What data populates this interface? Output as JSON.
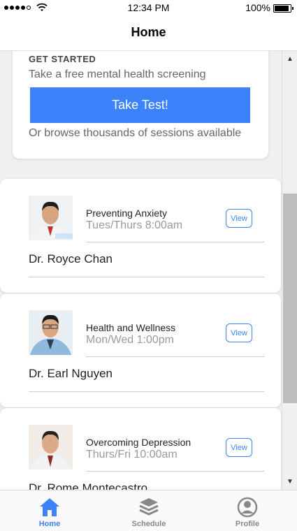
{
  "status_bar": {
    "time": "12:34 PM",
    "battery": "100%",
    "battery_level": 1.0
  },
  "header": {
    "title": "Home"
  },
  "get_started": {
    "heading": "GET STARTED",
    "subtitle": "Take a free mental health screening",
    "button": "Take Test!",
    "browse": "Or browse thousands of sessions available"
  },
  "sessions": [
    {
      "topic": "Preventing Anxiety",
      "schedule": "Tues/Thurs 8:00am",
      "doctor": "Dr. Royce Chan",
      "view": "View"
    },
    {
      "topic": "Health and Wellness",
      "schedule": "Mon/Wed 1:00pm",
      "doctor": "Dr. Earl Nguyen",
      "view": "View"
    },
    {
      "topic": "Overcoming Depression",
      "schedule": "Thurs/Fri 10:00am",
      "doctor": "Dr. Rome Montecastro",
      "view": "View"
    }
  ],
  "tabs": [
    {
      "label": "Home",
      "icon": "home-icon",
      "active": true
    },
    {
      "label": "Schedule",
      "icon": "layers-icon",
      "active": false
    },
    {
      "label": "Profile",
      "icon": "user-icon",
      "active": false
    }
  ],
  "colors": {
    "accent": "#3b82fb",
    "inactive": "#888888"
  }
}
